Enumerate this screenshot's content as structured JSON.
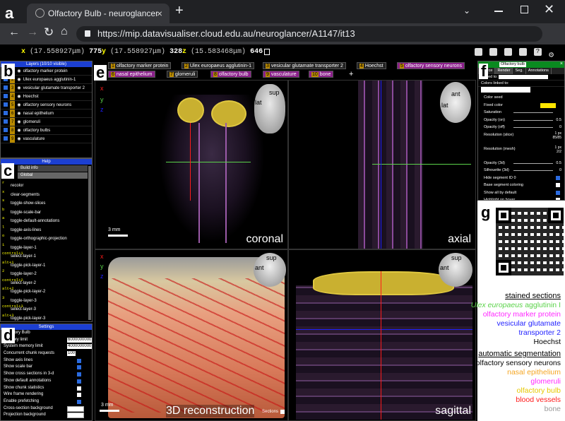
{
  "browser": {
    "tab_title": "Olfactory Bulb - neuroglancer",
    "url": "https://mip.datavisualiser.cloud.edu.au/neuroglancer/A1147/it13"
  },
  "coords": {
    "x_label": "x",
    "x_unit": "(17.558927μm)",
    "x_val": "775",
    "y_label": "y",
    "y_unit": "(17.558927μm)",
    "y_val": "328",
    "z_label": "z",
    "z_unit": "(15.583468μm)",
    "z_val": "646"
  },
  "letters": {
    "a": "a",
    "b": "b",
    "c": "c",
    "d": "d",
    "e": "e",
    "f": "f",
    "g": "g"
  },
  "layers_panel": {
    "title": "Layers (10/10 visible)",
    "items": [
      {
        "n": "1",
        "label": "olfactory marker protein"
      },
      {
        "n": "2",
        "label": "Ulex europaeus agglutinin-1"
      },
      {
        "n": "3",
        "label": "vesicular glutamate transporter 2"
      },
      {
        "n": "4",
        "label": "Hoechst"
      },
      {
        "n": "5",
        "label": "olfactory sensory neurons"
      },
      {
        "n": "6",
        "label": "nasal epithelium"
      },
      {
        "n": "7",
        "label": "glomeruli"
      },
      {
        "n": "8",
        "label": "olfactory bulbs"
      },
      {
        "n": "9",
        "label": "vasculature"
      }
    ]
  },
  "help_panel": {
    "title": "Help",
    "tabs": [
      "Build info",
      "Global"
    ],
    "entries": [
      {
        "k": "r",
        "v": "recolor"
      },
      {
        "k": "x",
        "v": "clear-segments"
      },
      {
        "k": "s",
        "v": "toggle-show-slices"
      },
      {
        "k": "b",
        "v": "toggle-scale-bar"
      },
      {
        "k": "a",
        "v": "toggle-default-annotations"
      },
      {
        "k": "l",
        "v": "toggle-axis-lines"
      },
      {
        "k": "o",
        "v": "toggle-orthographic-projection"
      },
      {
        "k": "1",
        "v": "toggle-layer-1"
      },
      {
        "k": "control+1",
        "v": "select-layer-1"
      },
      {
        "k": "alt+1",
        "v": "toggle-pick-layer-1"
      },
      {
        "k": "2",
        "v": "toggle-layer-2"
      },
      {
        "k": "control+2",
        "v": "select-layer-2"
      },
      {
        "k": "alt+2",
        "v": "toggle-pick-layer-2"
      },
      {
        "k": "3",
        "v": "toggle-layer-3"
      },
      {
        "k": "control+3",
        "v": "select-layer-3"
      },
      {
        "k": "alt+3",
        "v": "toggle-pick-layer-3"
      }
    ]
  },
  "settings_panel": {
    "title": "Settings",
    "rows": [
      {
        "l": "Olfactory Bulb",
        "v": ""
      },
      {
        "l": "Memory limit",
        "v": "6000000000"
      },
      {
        "l": "System memory limit",
        "v": "4000000000"
      },
      {
        "l": "Concurrent chunk requests",
        "v": "100"
      },
      {
        "l": "Show axis lines",
        "v": "check"
      },
      {
        "l": "Show scale bar",
        "v": "check"
      },
      {
        "l": "Show cross sections in 3-d",
        "v": "check"
      },
      {
        "l": "Show default annotations",
        "v": "check"
      },
      {
        "l": "Show chunk statistics",
        "v": "box"
      },
      {
        "l": "Wire frame rendering",
        "v": "box"
      },
      {
        "l": "Enable prefetching",
        "v": "check"
      },
      {
        "l": "Cross-section background",
        "v": "swatch"
      },
      {
        "l": "Projection background",
        "v": "swatch"
      }
    ]
  },
  "layer_tabs": [
    {
      "n": "1",
      "label": "olfactory marker protein"
    },
    {
      "n": "2",
      "label": "Ulex europaeus agglutinin-1"
    },
    {
      "n": "3",
      "label": "vesicular glutamate transporter 2"
    },
    {
      "n": "4",
      "label": "Hoechst"
    },
    {
      "n": "5",
      "label": "olfactory sensory neurons"
    },
    {
      "n": "6",
      "label": "nasal epithelium"
    },
    {
      "n": "7",
      "label": "glomeruli"
    },
    {
      "n": "8",
      "label": "olfactory bulb"
    },
    {
      "n": "9",
      "label": "vasculature"
    },
    {
      "n": "10",
      "label": "bone"
    }
  ],
  "add_layer": "+",
  "views": {
    "coronal": "coronal",
    "axial": "axial",
    "recon": "3D reconstruction",
    "sagittal": "sagittal",
    "scale_coronal": "3 mm",
    "scale_recon": "3 mm",
    "sections": "Sections"
  },
  "orient": {
    "sup": "sup",
    "lat": "lat",
    "ant": "ant"
  },
  "axes": {
    "x": "x",
    "y": "y",
    "z": "z"
  },
  "seg_panel": {
    "name": "Olfactory bulb",
    "tabs": [
      "Source",
      "Render",
      "Seg.",
      "Annotations"
    ],
    "linked_to": "Linked to:",
    "colors_linked": "Colors linked to:",
    "rows": [
      "Color seed",
      "Fixed color",
      "Saturation",
      "Opacity (on)",
      "Opacity (off)",
      "Resolution (slice)",
      "Resolution (mesh)",
      "Opacity (3d)",
      "Silhouette (3d)",
      "Hide segment ID 0",
      "Base segment coloring",
      "Show all by default",
      "Highlight on hover"
    ],
    "vals": {
      "opacity_on": "0.5",
      "opacity_off": "0",
      "res_slice": "1 px\n85/85",
      "res_mesh": "1 px\n2/2",
      "opacity_3d": "0.5",
      "silhouette": "0"
    }
  },
  "legend_stained": {
    "title": "stained sections",
    "l1a": "Ulex europaeus",
    "l1b": " agglutinin I",
    "l2": "olfactory marker protein",
    "l3": "vesicular glutamate",
    "l4": "transporter 2",
    "l5": "Hoechst"
  },
  "legend_auto": {
    "title": "automatic segmentation",
    "items": [
      "olfactory sensory neurons",
      "nasal epithelium",
      "glomeruli",
      "olfactory bulb",
      "blood vessels",
      "bone"
    ]
  },
  "colors": {
    "green": "#5bd34a",
    "magenta": "#ff2bff",
    "blue": "#1f1fff",
    "orange": "#f5a623",
    "yellow": "#ffe600",
    "red": "#ff1b1b",
    "grey": "#9a9a9a",
    "accent": "#1c3fd1"
  }
}
